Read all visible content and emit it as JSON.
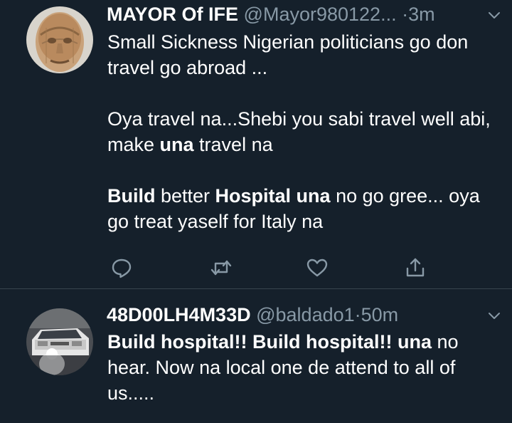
{
  "tweets": [
    {
      "display_name": "MAYOR Of IFE",
      "handle": "@Mayor980122...",
      "dot": "·",
      "time": "3m",
      "body": {
        "p1": "Small Sickness Nigerian politicians go don travel go abroad ...",
        "p2_a": "Oya travel na...Shebi you sabi travel well abi, make ",
        "p2_bold": "una",
        "p2_b": " travel na",
        "p3_bold1": "Build",
        "p3_a": " better ",
        "p3_bold2": "Hospital una",
        "p3_b": " no go gree... oya go treat yaself for Italy na"
      },
      "actions": [
        "reply-icon",
        "retweet-icon",
        "like-icon",
        "share-icon"
      ]
    },
    {
      "display_name": "48D00LH4M33D",
      "handle": "@baldado1",
      "dot": "·",
      "time": "50m",
      "body": {
        "bold1": "Build hospital!! Build hospital!! una",
        "a": " no hear. Now na local one de attend to all of us....."
      }
    }
  ],
  "colors": {
    "background": "#15202b",
    "secondary_text": "#8899a6",
    "divider": "#38444d"
  }
}
